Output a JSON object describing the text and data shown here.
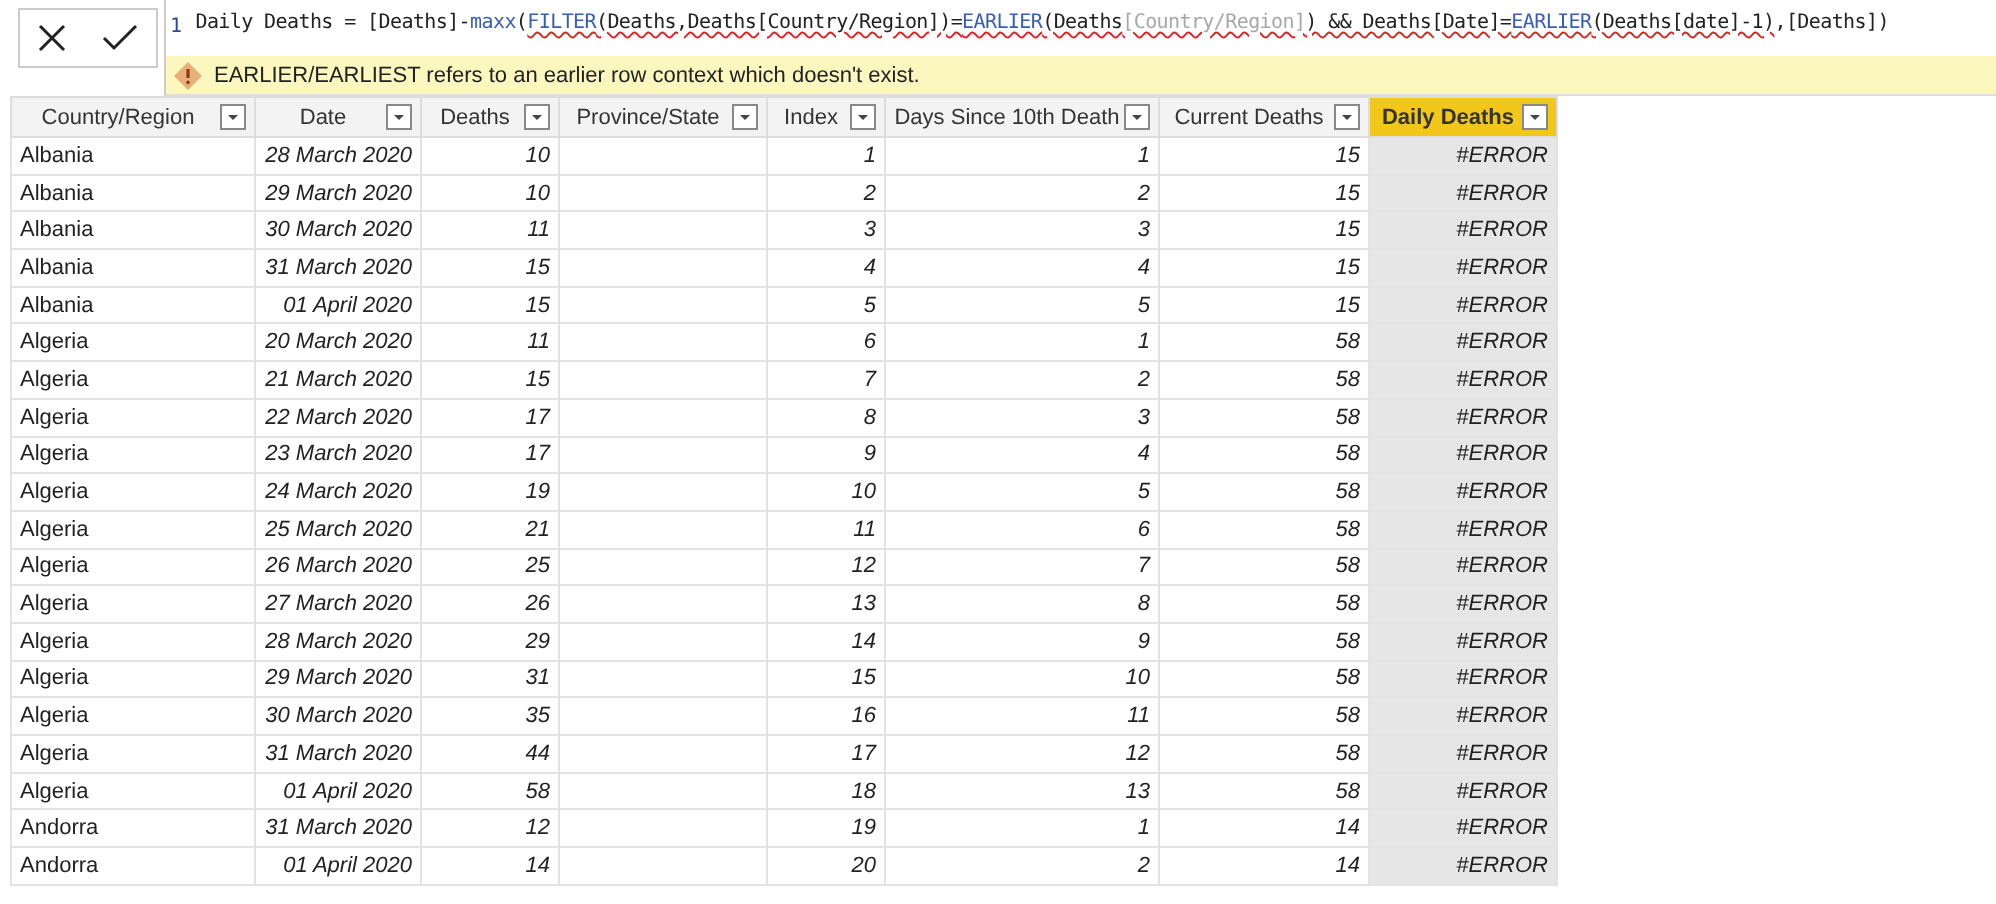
{
  "formula_bar": {
    "line_number": "1",
    "segments": [
      {
        "text": "Daily Deaths = [Deaths]-",
        "kind": "plain",
        "squiggle": false
      },
      {
        "text": "maxx",
        "kind": "function",
        "squiggle": false
      },
      {
        "text": "(",
        "kind": "plain",
        "squiggle": false
      },
      {
        "text": "FILTER",
        "kind": "function",
        "squiggle": true
      },
      {
        "text": "(Deaths,Deaths[Country/Region])=",
        "kind": "plain",
        "squiggle": true
      },
      {
        "text": "EARLIER",
        "kind": "function",
        "squiggle": true
      },
      {
        "text": "(Deaths",
        "kind": "plain",
        "squiggle": true
      },
      {
        "text": "[Country/Region]",
        "kind": "dim",
        "squiggle": true
      },
      {
        "text": ") && Deaths[Date]=",
        "kind": "plain",
        "squiggle": true
      },
      {
        "text": "EARLIER",
        "kind": "function",
        "squiggle": true
      },
      {
        "text": "(Deaths[date]-1)",
        "kind": "plain",
        "squiggle": true
      },
      {
        "text": ",[Deaths])",
        "kind": "plain",
        "squiggle": false
      }
    ],
    "error": "EARLIER/EARLIEST refers to an earlier row context which doesn't exist."
  },
  "table": {
    "columns": [
      {
        "label": "Country/Region",
        "selected": false
      },
      {
        "label": "Date",
        "selected": false
      },
      {
        "label": "Deaths",
        "selected": false
      },
      {
        "label": "Province/State",
        "selected": false
      },
      {
        "label": "Index",
        "selected": false
      },
      {
        "label": "Days Since 10th Death",
        "selected": false
      },
      {
        "label": "Current Deaths",
        "selected": false
      },
      {
        "label": "Daily Deaths",
        "selected": true
      }
    ],
    "rows": [
      [
        "Albania",
        "28 March 2020",
        "10",
        null,
        "1",
        "1",
        "15",
        "#ERROR"
      ],
      [
        "Albania",
        "29 March 2020",
        "10",
        null,
        "2",
        "2",
        "15",
        "#ERROR"
      ],
      [
        "Albania",
        "30 March 2020",
        "11",
        null,
        "3",
        "3",
        "15",
        "#ERROR"
      ],
      [
        "Albania",
        "31 March 2020",
        "15",
        null,
        "4",
        "4",
        "15",
        "#ERROR"
      ],
      [
        "Albania",
        "01 April 2020",
        "15",
        null,
        "5",
        "5",
        "15",
        "#ERROR"
      ],
      [
        "Algeria",
        "20 March 2020",
        "11",
        null,
        "6",
        "1",
        "58",
        "#ERROR"
      ],
      [
        "Algeria",
        "21 March 2020",
        "15",
        null,
        "7",
        "2",
        "58",
        "#ERROR"
      ],
      [
        "Algeria",
        "22 March 2020",
        "17",
        null,
        "8",
        "3",
        "58",
        "#ERROR"
      ],
      [
        "Algeria",
        "23 March 2020",
        "17",
        null,
        "9",
        "4",
        "58",
        "#ERROR"
      ],
      [
        "Algeria",
        "24 March 2020",
        "19",
        null,
        "10",
        "5",
        "58",
        "#ERROR"
      ],
      [
        "Algeria",
        "25 March 2020",
        "21",
        null,
        "11",
        "6",
        "58",
        "#ERROR"
      ],
      [
        "Algeria",
        "26 March 2020",
        "25",
        null,
        "12",
        "7",
        "58",
        "#ERROR"
      ],
      [
        "Algeria",
        "27 March 2020",
        "26",
        null,
        "13",
        "8",
        "58",
        "#ERROR"
      ],
      [
        "Algeria",
        "28 March 2020",
        "29",
        null,
        "14",
        "9",
        "58",
        "#ERROR"
      ],
      [
        "Algeria",
        "29 March 2020",
        "31",
        null,
        "15",
        "10",
        "58",
        "#ERROR"
      ],
      [
        "Algeria",
        "30 March 2020",
        "35",
        null,
        "16",
        "11",
        "58",
        "#ERROR"
      ],
      [
        "Algeria",
        "31 March 2020",
        "44",
        null,
        "17",
        "12",
        "58",
        "#ERROR"
      ],
      [
        "Algeria",
        "01 April 2020",
        "58",
        null,
        "18",
        "13",
        "58",
        "#ERROR"
      ],
      [
        "Andorra",
        "31 March 2020",
        "12",
        null,
        "19",
        "1",
        "14",
        "#ERROR"
      ],
      [
        "Andorra",
        "01 April 2020",
        "14",
        null,
        "20",
        "2",
        "14",
        "#ERROR"
      ]
    ]
  }
}
